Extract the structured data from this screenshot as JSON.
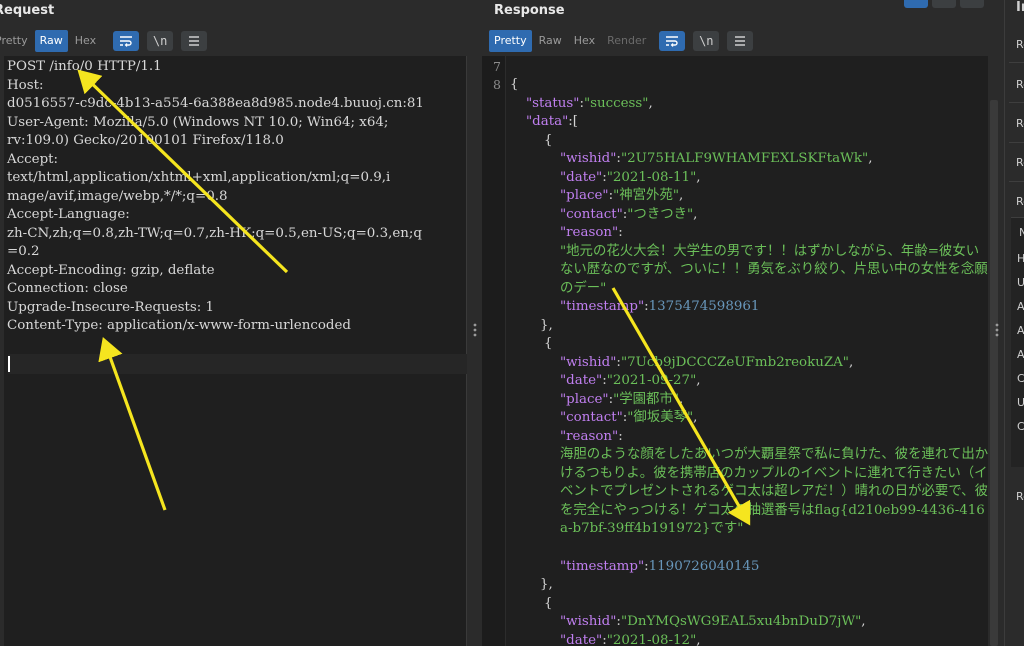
{
  "request": {
    "title": "Request",
    "tabs": [
      "Pretty",
      "Raw",
      "Hex"
    ],
    "active_tab": "Raw",
    "lines": [
      "POST /info/0 HTTP/1.1",
      "Host:",
      "d0516557-c9dc-4b13-a554-6a388ea8d985.node4.buuoj.cn:81",
      "User-Agent: Mozilla/5.0 (Windows NT 10.0; Win64; x64;",
      "rv:109.0) Gecko/20100101 Firefox/118.0",
      "Accept:",
      "text/html,application/xhtml+xml,application/xml;q=0.9,i",
      "mage/avif,image/webp,*/*;q=0.8",
      "Accept-Language:",
      "zh-CN,zh;q=0.8,zh-TW;q=0.7,zh-HK;q=0.5,en-US;q=0.3,en;q",
      "=0.2",
      "Accept-Encoding: gzip, deflate",
      "Connection: close",
      "Upgrade-Insecure-Requests: 1",
      "Content-Type: application/x-www-form-urlencoded"
    ]
  },
  "response": {
    "title": "Response",
    "tabs": [
      "Pretty",
      "Raw",
      "Hex",
      "Render"
    ],
    "active_tab": "Pretty",
    "line_numbers": [
      "7",
      "8"
    ],
    "json": {
      "status_key": "\"status\"",
      "status_val": "\"success\"",
      "data_key": "\"data\"",
      "items": [
        {
          "wishid": "\"2U75HALF9WHAMFEXLSKFtaWk\"",
          "date": "\"2021-08-11\"",
          "place": "\"神宮外苑\"",
          "contact": "\"つきつき\"",
          "reason": "\"地元の花火大会！大学生の男です！！はずかしながら、年齢=彼女いない歴なのですが、ついに！！勇気をぶり絞り、片思い中の女性を念願のデー\"",
          "timestamp": "1375474598961"
        },
        {
          "wishid": "\"7Ucb9jDCCCZeUFmb2reokuZA\"",
          "date": "\"2021-09-27\"",
          "place": "\"学園都市\"",
          "contact": "\"御坂美琴\"",
          "reason": "海胆のような顔をしたあいつが大覇星祭で私に負けた、彼を連れて出かけるつもりよ。彼を携帯店のカップルのイベントに連れて行きたい（イベントでプレゼントされるゲコ太は超レアだ！）晴れの日が必要で、彼を完全にやっつける！ゲコ太の抽選番号はflag{d210eb99-4436-416a-b7bf-39ff4b191972}です\"",
          "timestamp": "1190726040145"
        },
        {
          "wishid": "\"DnYMQsWG9EAL5xu4bnDuD7jW\"",
          "date": "\"2021-08-12\""
        }
      ],
      "keys": {
        "wishid": "\"wishid\"",
        "date": "\"date\"",
        "place": "\"place\"",
        "contact": "\"contact\"",
        "reason": "\"reason\"",
        "timestamp": "\"timestamp\""
      }
    }
  },
  "inspector": {
    "title": "In",
    "rows": [
      "Re",
      "Re",
      "Re",
      "Re",
      "Re"
    ],
    "table_head": "N",
    "table_rows": [
      "H",
      "U",
      "A",
      "A",
      "A",
      "C",
      "U",
      "C"
    ],
    "last_row": "Re"
  },
  "toolbar_icons": [
    "wrap-lines-icon",
    "newline-toggle-icon",
    "menu-icon"
  ],
  "colors": {
    "accent": "#2f6bb0",
    "json_key": "#c07ff0",
    "json_string": "#6bbf59",
    "json_number": "#6897bb",
    "annotation_arrow": "#f5e51f"
  }
}
